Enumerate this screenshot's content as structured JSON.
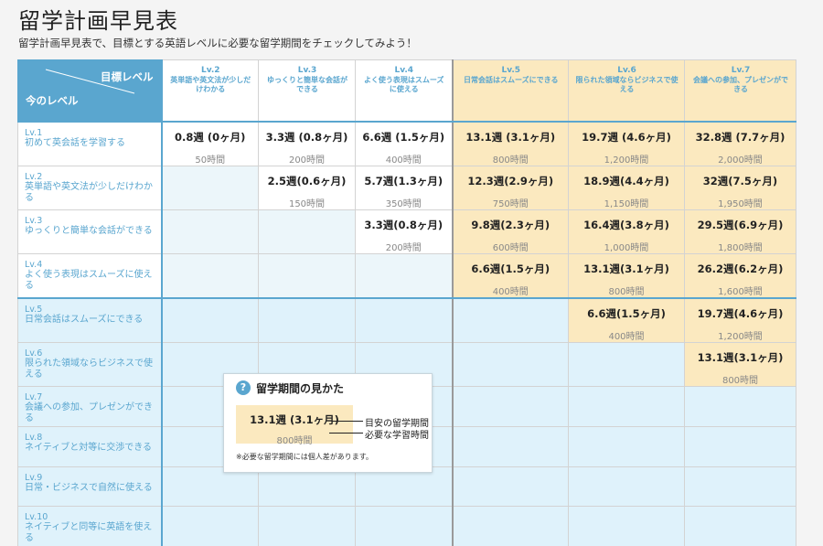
{
  "title": "留学計画早見表",
  "description": "留学計画早見表で、目標とする英語レベルに必要な留学期間をチェックしてみよう！",
  "corner": {
    "target_label": "目標レベル",
    "current_label": "今のレベル"
  },
  "columns": [
    {
      "lv": "Lv.2",
      "desc": "英単語や英文法が少しだけわかる"
    },
    {
      "lv": "Lv.3",
      "desc": "ゆっくりと簡単な会話ができる"
    },
    {
      "lv": "Lv.4",
      "desc": "よく使う表現はスムーズに使える"
    },
    {
      "lv": "Lv.5",
      "desc": "日常会話はスムーズにできる"
    },
    {
      "lv": "Lv.6",
      "desc": "限られた領域ならビジネスで使える"
    },
    {
      "lv": "Lv.7",
      "desc": "会議への参加、プレゼンができる"
    }
  ],
  "rows": [
    {
      "lv": "Lv.1",
      "desc": "初めて英会話を学習する",
      "cells": [
        {
          "weeks": "0.8週 (0ヶ月)",
          "hours": "50時間"
        },
        {
          "weeks": "3.3週 (0.8ヶ月)",
          "hours": "200時間"
        },
        {
          "weeks": "6.6週 (1.5ヶ月)",
          "hours": "400時間"
        },
        {
          "weeks": "13.1週 (3.1ヶ月)",
          "hours": "800時間"
        },
        {
          "weeks": "19.7週 (4.6ヶ月)",
          "hours": "1,200時間"
        },
        {
          "weeks": "32.8週 (7.7ヶ月)",
          "hours": "2,000時間"
        }
      ]
    },
    {
      "lv": "Lv.2",
      "desc": "英単語や英文法が少しだけわかる",
      "cells": [
        null,
        {
          "weeks": "2.5週(0.6ヶ月)",
          "hours": "150時間"
        },
        {
          "weeks": "5.7週(1.3ヶ月)",
          "hours": "350時間"
        },
        {
          "weeks": "12.3週(2.9ヶ月)",
          "hours": "750時間"
        },
        {
          "weeks": "18.9週(4.4ヶ月)",
          "hours": "1,150時間"
        },
        {
          "weeks": "32週(7.5ヶ月)",
          "hours": "1,950時間"
        }
      ]
    },
    {
      "lv": "Lv.3",
      "desc": "ゆっくりと簡単な会話ができる",
      "cells": [
        null,
        null,
        {
          "weeks": "3.3週(0.8ヶ月)",
          "hours": "200時間"
        },
        {
          "weeks": "9.8週(2.3ヶ月)",
          "hours": "600時間"
        },
        {
          "weeks": "16.4週(3.8ヶ月)",
          "hours": "1,000時間"
        },
        {
          "weeks": "29.5週(6.9ヶ月)",
          "hours": "1,800時間"
        }
      ]
    },
    {
      "lv": "Lv.4",
      "desc": "よく使う表現はスムーズに使える",
      "cells": [
        null,
        null,
        null,
        {
          "weeks": "6.6週(1.5ヶ月)",
          "hours": "400時間"
        },
        {
          "weeks": "13.1週(3.1ヶ月)",
          "hours": "800時間"
        },
        {
          "weeks": "26.2週(6.2ヶ月)",
          "hours": "1,600時間"
        }
      ]
    },
    {
      "lv": "Lv.5",
      "desc": "日常会話はスムーズにできる",
      "cells": [
        null,
        null,
        null,
        null,
        {
          "weeks": "6.6週(1.5ヶ月)",
          "hours": "400時間"
        },
        {
          "weeks": "19.7週(4.6ヶ月)",
          "hours": "1,200時間"
        }
      ]
    },
    {
      "lv": "Lv.6",
      "desc": "限られた領域ならビジネスで使える",
      "cells": [
        null,
        null,
        null,
        null,
        null,
        {
          "weeks": "13.1週(3.1ヶ月)",
          "hours": "800時間"
        }
      ]
    },
    {
      "lv": "Lv.7",
      "desc": "会議への参加、プレゼンができる",
      "cells": [
        null,
        null,
        null,
        null,
        null,
        null
      ]
    },
    {
      "lv": "Lv.8",
      "desc": "ネイティブと対等に交渉できる",
      "cells": [
        null,
        null,
        null,
        null,
        null,
        null
      ]
    },
    {
      "lv": "Lv.9",
      "desc": "日常・ビジネスで自然に使える",
      "cells": [
        null,
        null,
        null,
        null,
        null,
        null
      ]
    },
    {
      "lv": "Lv.10",
      "desc": "ネイティブと同等に英語を使える",
      "cells": [
        null,
        null,
        null,
        null,
        null,
        null
      ]
    }
  ],
  "legend": {
    "icon": "question-icon",
    "title": "留学期間の見かた",
    "sample_weeks": "13.1週 (3.1ヶ月)",
    "sample_hours": "800時間",
    "label_period": "目安の留学期間",
    "label_hours": "必要な学習時間",
    "note": "※必要な留学期間には個人差があります。"
  },
  "colors": {
    "accent": "#5aa6cf",
    "warm": "#fbe9bf",
    "pale_blue": "#dff2fb"
  }
}
